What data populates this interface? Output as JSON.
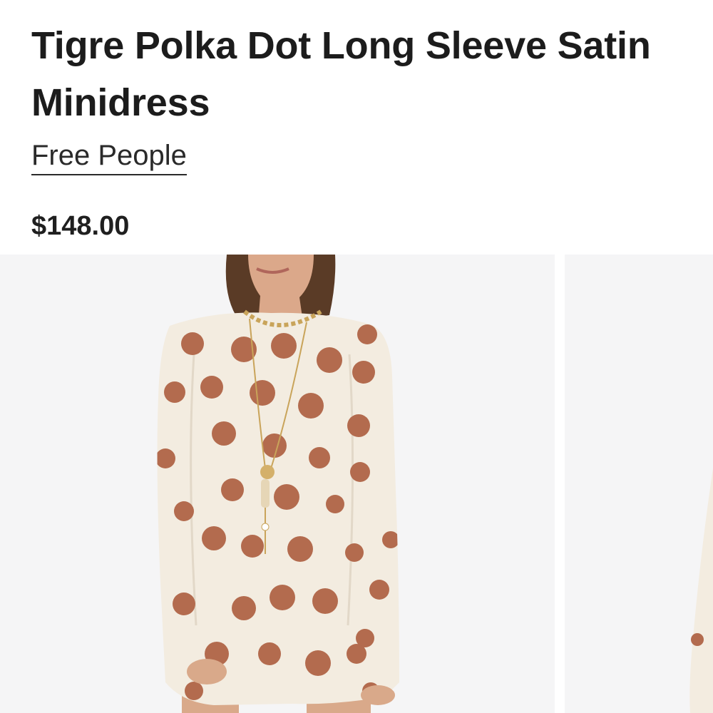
{
  "product": {
    "title": "Tigre Polka Dot Long Sleeve Satin Minidress",
    "brand": "Free People",
    "price": "$148.00"
  },
  "gallery": {
    "images": [
      {
        "description": "model-wearing-polka-dot-dress"
      },
      {
        "description": "next-product-image-partial"
      }
    ]
  },
  "colors": {
    "dress": "#f3ece0",
    "dots": "#b36b4e",
    "background": "#f5f5f6",
    "hair": "#5a3b26",
    "skin": "#d9a98a"
  }
}
